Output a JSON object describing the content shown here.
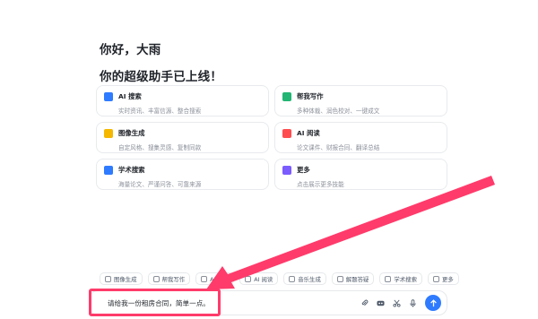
{
  "greeting": {
    "line1": "你好，大雨",
    "line2": "你的超级助手已上线！"
  },
  "cards": [
    {
      "title": "AI 搜索",
      "desc": "实时资讯、丰富信源、整合搜索",
      "icon": "search-icon",
      "color": "#2f7bff"
    },
    {
      "title": "帮我写作",
      "desc": "多种体裁、润色校对、一键成文",
      "icon": "pen-icon",
      "color": "#22b573"
    },
    {
      "title": "图像生成",
      "desc": "自定风格、搜集灵感、复制同款",
      "icon": "image-icon",
      "color": "#f5b700"
    },
    {
      "title": "AI 阅读",
      "desc": "论文课件、财报合同、翻译总结",
      "icon": "book-icon",
      "color": "#ff4d4f"
    },
    {
      "title": "学术搜索",
      "desc": "海量论文、严谨问答、可靠来源",
      "icon": "academic-icon",
      "color": "#2f7bff"
    },
    {
      "title": "更多",
      "desc": "点击展示更多技能",
      "icon": "grid-icon",
      "color": "#7a5cff"
    }
  ],
  "toolbar": [
    {
      "label": "图像生成",
      "icon": "image-icon"
    },
    {
      "label": "帮我写作",
      "icon": "pen-icon"
    },
    {
      "label": "AI 搜索",
      "icon": "search-icon"
    },
    {
      "label": "AI 阅读",
      "icon": "book-icon"
    },
    {
      "label": "音乐生成",
      "icon": "music-icon"
    },
    {
      "label": "解题答疑",
      "icon": "question-icon"
    },
    {
      "label": "学术搜索",
      "icon": "academic-icon"
    },
    {
      "label": "更多",
      "icon": "grid-icon"
    }
  ],
  "input": {
    "value": "请给我一份租房合同，简单一点。"
  },
  "input_tools": [
    "attach-icon",
    "voice-call-icon",
    "scissors-icon",
    "mic-icon"
  ],
  "colors": {
    "accent": "#2f7bff",
    "highlight": "#ff3b6b"
  }
}
